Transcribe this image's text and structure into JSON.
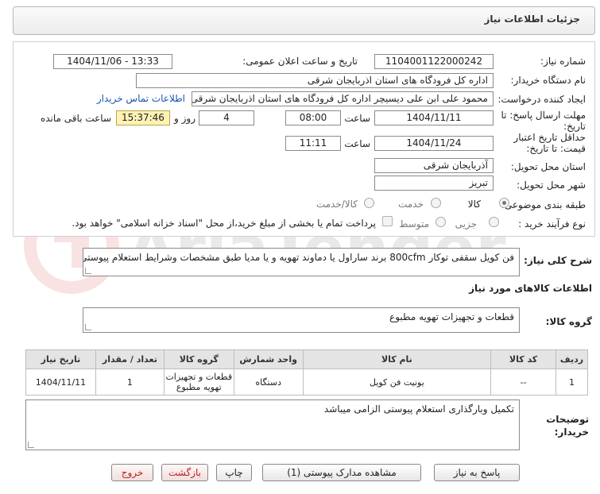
{
  "header": {
    "title": "جزئیات اطلاعات نیاز"
  },
  "form": {
    "need_number_label": "شماره نیاز:",
    "need_number": "1104001122000242",
    "announce_label": "تاریخ و ساعت اعلان عمومی:",
    "announce_value": "1404/11/06 - 13:33",
    "buyer_label": "نام دستگاه خریدار:",
    "buyer_value": "اداره کل فرودگاه های استان اذربایجان شرقی",
    "creator_label": "ایجاد کننده درخواست:",
    "creator_value": "محمود علی ابن علی دیسیچر اداره کل فرودگاه های استان اذربایجان شرقی",
    "contact_link": "اطلاعات تماس خریدار",
    "deadline_label_1": "مهلت ارسال پاسخ: تا",
    "deadline_label_2": "تاریخ:",
    "deadline_date": "1404/11/11",
    "hour_label": "ساعت",
    "deadline_time": "08:00",
    "days_value": "4",
    "days_label": "روز و",
    "remaining_time": "15:37:46",
    "remaining_label": "ساعت باقی مانده",
    "validity_label_1": "حداقل تاریخ اعتبار",
    "validity_label_2": "قیمت: تا تاریخ:",
    "validity_date": "1404/11/24",
    "validity_hour_label": "ساعت",
    "validity_time": "11:11",
    "province_label": "استان محل تحویل:",
    "province_value": "آذربایجان شرقی",
    "city_label": "شهر محل تحویل:",
    "city_value": "تبریز",
    "category_label": "طبقه بندی موضوعی:",
    "category_options": [
      "کالا",
      "خدمت",
      "کالا/خدمت"
    ],
    "process_label": "نوع فرآیند خرید :",
    "process_options": [
      "جزیی",
      "متوسط"
    ],
    "payment_note": "پرداخت تمام یا بخشی از مبلغ خرید،از محل \"اسناد خزانه اسلامی\" خواهد بود."
  },
  "summary": {
    "label": "شرح کلی نیاز:",
    "value": "فن کویل سقفی توکار 800cfm  برند ساراول یا دماوند تهویه و یا مدیا طبق مشخصات وشرایط استعلام پیوستی"
  },
  "goods": {
    "section_title": "اطلاعات کالاهای مورد نیاز",
    "group_label": "گروه کالا:",
    "group_value": "قطعات و تجهیزات تهویه مطبوع"
  },
  "table": {
    "headers": [
      "ردیف",
      "کد کالا",
      "نام کالا",
      "واحد شمارش",
      "گروه کالا",
      "تعداد / مقدار",
      "تاریخ نیاز"
    ],
    "rows": [
      [
        "1",
        "--",
        "یونیت فن کویل",
        "دستگاه",
        "قطعات و تجهیزات تهویه مطبوع",
        "1",
        "1404/11/11"
      ]
    ]
  },
  "buyer_notes": {
    "label_1": "توضیحات",
    "label_2": "خریدار:",
    "value": "تکمیل وبارگذاری استعلام پیوستی الزامی میباشد"
  },
  "buttons": {
    "reply": "پاسخ به نیاز",
    "attachments": "مشاهده مدارک پیوستی (1)",
    "print": "چاپ",
    "back": "بازگشت",
    "exit": "خروج"
  },
  "watermark": {
    "text": "AriaTender.neT"
  },
  "colors": {
    "link": "#1a55b0",
    "highlight": "#fff2b3",
    "exit": "#b22222"
  }
}
